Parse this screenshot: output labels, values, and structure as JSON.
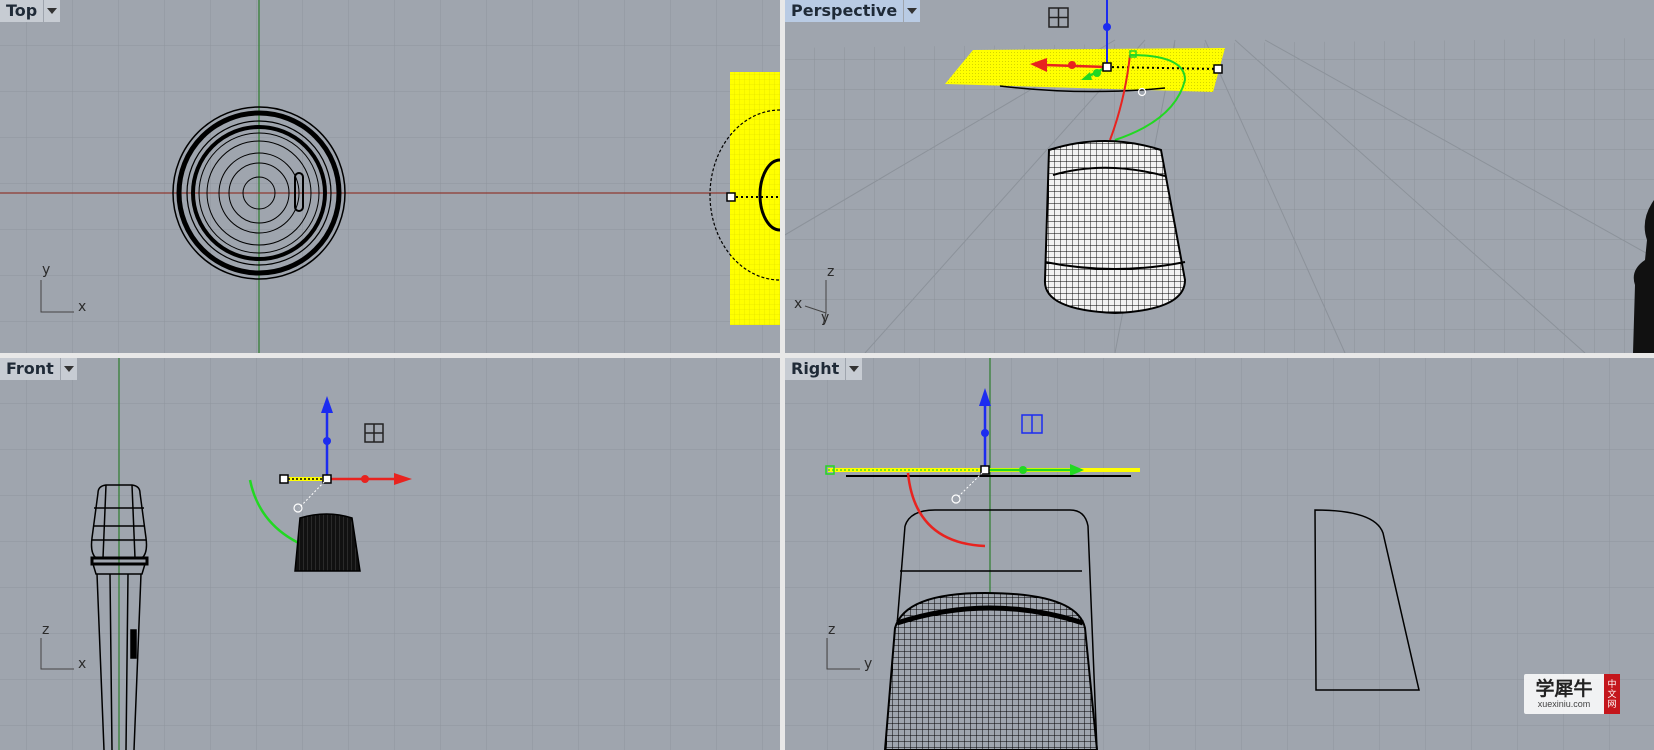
{
  "viewports": {
    "top": {
      "label": "Top",
      "axes": {
        "vertical": "y",
        "horizontal": "x"
      }
    },
    "perspective": {
      "label": "Perspective",
      "axes": {
        "up": "z",
        "left": "x",
        "depth": "y"
      }
    },
    "front": {
      "label": "Front",
      "axes": {
        "vertical": "z",
        "horizontal": "x"
      }
    },
    "right": {
      "label": "Right",
      "axes": {
        "vertical": "z",
        "horizontal": "y"
      }
    }
  },
  "watermark": {
    "cn": "学犀牛",
    "en": "xuexiniu.com",
    "side": [
      "中",
      "文",
      "网"
    ]
  },
  "colors": {
    "viewport_bg": "#9fa5ae",
    "grid": "#8e949c",
    "x_axis": "#e8231f",
    "y_axis": "#22d822",
    "z_axis": "#1c2cf0",
    "selection": "#ffff00",
    "active_tab": "#b9cbe4"
  }
}
